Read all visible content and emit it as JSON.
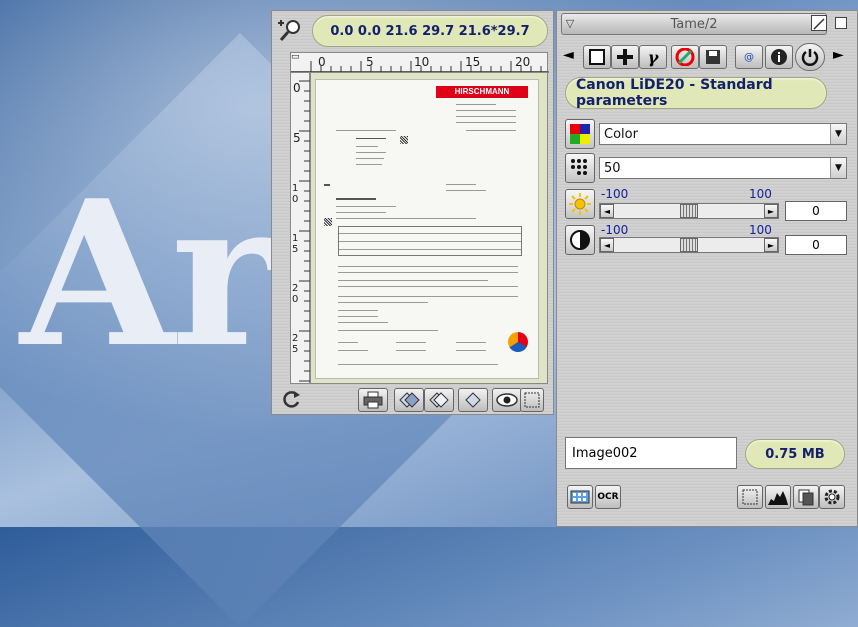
{
  "desktop": {
    "background_text": "Ar",
    "accent": "#2f5d9a"
  },
  "preview": {
    "coords": "0.0 0.0 21.6 29.7  21.6*29.7",
    "ruler_h_ticks": [
      "0",
      "5",
      "10",
      "15",
      "20"
    ],
    "ruler_v_ticks": [
      "0",
      "5",
      "10",
      "15",
      "20",
      "25"
    ],
    "document": {
      "brand": "HIRSCHMANN"
    },
    "icons": {
      "zoom": "zoom-icon",
      "refresh": "refresh-icon",
      "print": "printer-icon"
    }
  },
  "tame": {
    "title": "Tame/2",
    "profile": "Canon LiDE20 - Standard parameters",
    "mode_value": "Color",
    "resolution_value": "50",
    "brightness": {
      "min": "-100",
      "max": "100",
      "value": "0"
    },
    "contrast": {
      "min": "-100",
      "max": "100",
      "value": "0"
    },
    "filename": "Image002",
    "filesize": "0.75 MB",
    "ocr_label": "OCR",
    "pill_color": "#dfe8b6",
    "text_color": "#14206e"
  }
}
